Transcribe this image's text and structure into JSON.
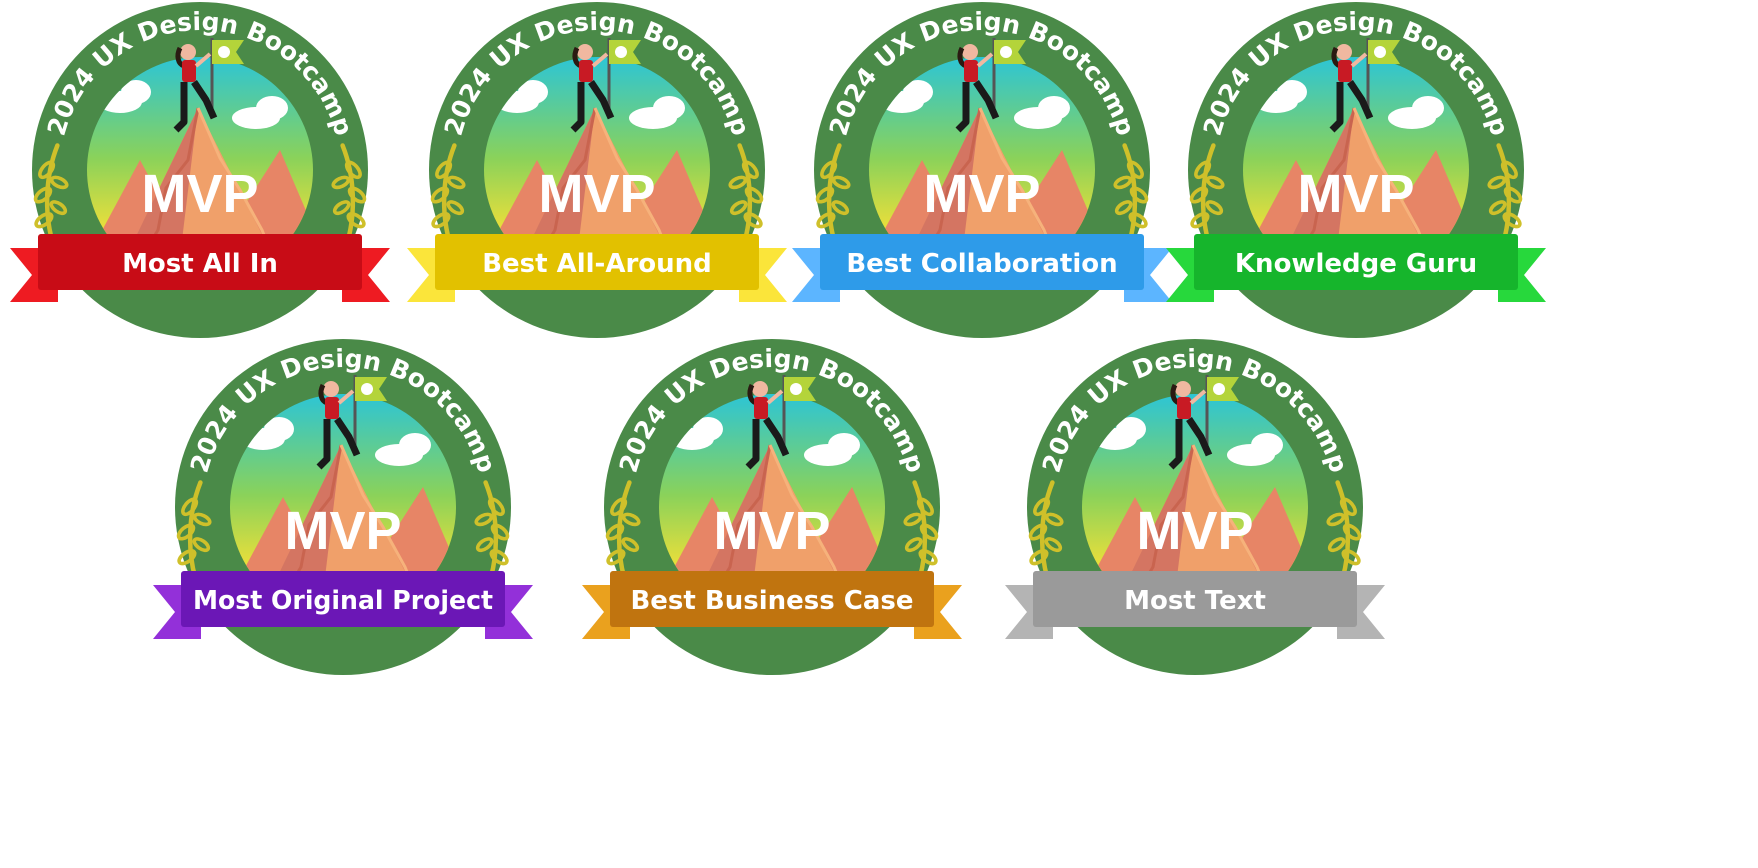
{
  "badge_common": {
    "arc_title": "2024 UX Design Bootcamp",
    "center_label": "MVP",
    "ring_color": "#4a8a48",
    "laurel_color": "#cfc02a",
    "flag_color": "#b4d43a"
  },
  "badges": [
    {
      "award": "Most All In",
      "ribbon_color": "#c80c16",
      "ribbon_tail_color": "#ee1b22"
    },
    {
      "award": "Best All-Around",
      "ribbon_color": "#e2c100",
      "ribbon_tail_color": "#fbe53a"
    },
    {
      "award": "Best Collaboration",
      "ribbon_color": "#2e9be9",
      "ribbon_tail_color": "#5cb5ff"
    },
    {
      "award": "Knowledge Guru",
      "ribbon_color": "#16b52c",
      "ribbon_tail_color": "#27d83c"
    },
    {
      "award": "Most Original Project",
      "ribbon_color": "#6b17b6",
      "ribbon_tail_color": "#9330d9"
    },
    {
      "award": "Best Business Case",
      "ribbon_color": "#c0740f",
      "ribbon_tail_color": "#eaa11e"
    },
    {
      "award": "Most Text",
      "ribbon_color": "#9a9a9a",
      "ribbon_tail_color": "#b4b4b4"
    }
  ]
}
